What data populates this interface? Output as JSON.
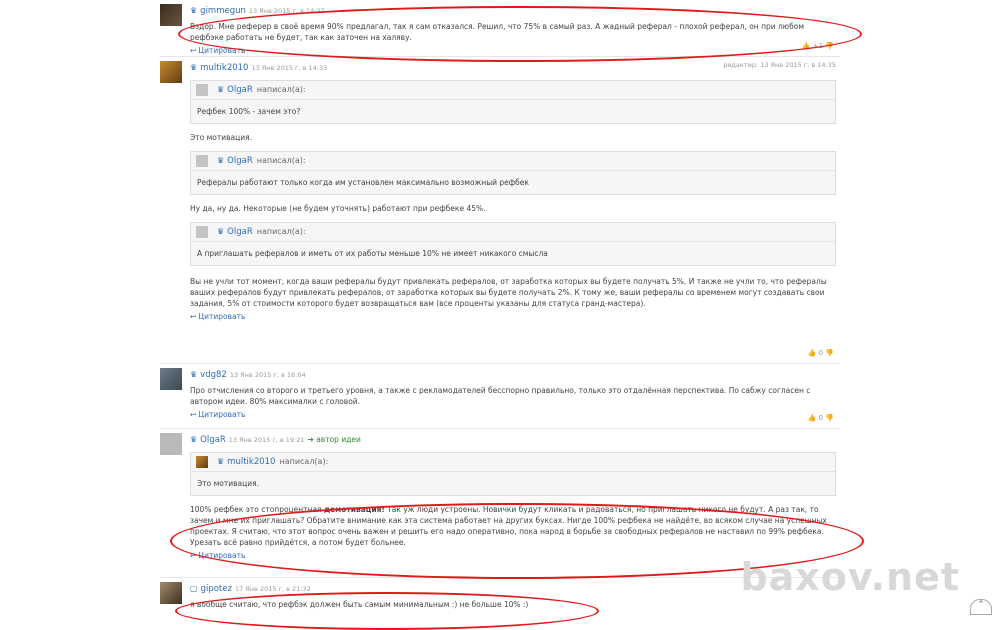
{
  "posts": [
    {
      "user": "gimmegun",
      "date": "13 Янв 2015 г, в 14:27",
      "text": "Вздор. Мне реферер в своё время 90% предлагал, так я сам отказался. Решил, что 75% в самый раз. А жадный реферал - плохой реферал, он при любом рефбэке работать не будет, так как заточен на халяву.",
      "cite": "Цитировать",
      "votes": "+1"
    },
    {
      "user": "multik2010",
      "date": "13 Янв 2015 г, в 14:33",
      "edited": "редактир: 13 Янв 2015 г, в 14:35",
      "quote1_user": "OlgaR",
      "wrote": "написал(а):",
      "quote1": "Рефбек 100% - зачем это?",
      "text1": "Это мотивация.",
      "quote2_user": "OlgaR",
      "quote2": "Рефералы работают только когда им установлен максимально возможный рефбек",
      "text2": "Ну да, ну да. Некоторые (не будем уточнять) работают при рефбеке 45%.",
      "quote3_user": "OlgaR",
      "quote3": "А приглашать рефералов и иметь от их работы меньше 10% не имеет никакого смысла",
      "text3": "Вы не учли тот момент, когда ваши рефералы будут привлекать рефералов, от заработка которых вы будете получать 5%. И также не учли то, что рефералы ваших рефералов будут привлекать рефералов, от заработка которых вы будете получать 2%. К тому же, ваши рефералы со временем могут создавать свои задания, 5% от стоимости которого будет возвращаться вам (все проценты указаны для статуса гранд-мастера).",
      "cite": "Цитировать",
      "votes": "0"
    },
    {
      "user": "vdg82",
      "date": "13 Янв 2015 г, в 16:04",
      "text": "Про отчисления со второго и третьего уровня, а также с рекламодателей бесспорно правильно, только это отдалённая перспектива. По сабжу согласен с автором идеи. 80% максималки с головой.",
      "cite": "Цитировать",
      "votes": "0"
    },
    {
      "user": "OlgaR",
      "date": "13 Янв 2015 г, в 19:21",
      "author": "автор идеи",
      "quote1_user": "multik2010",
      "wrote": "написал(а):",
      "quote1": "Это мотивация.",
      "text_pre": "100% рефбек это стопроцентная ",
      "text_bold": "демотивация!",
      "text_post": " Так уж люди устроены. Новички будут кликать и радоваться, но приглашать никого не будут. А раз так, то зачем и мне их приглашать? Обратите внимание как эта система работает на других буксах. Нигде 100% рефбека не найдёте, во всяком случае на успешных проектах. Я считаю, что этот вопрос очень важен и решить его надо оперативно, пока народ в борьбе за свободных рефералов не наставил по 99% рефбека. Урезать всё равно прийдётся, а потом будет больнее.",
      "cite": "Цитировать",
      "votes": "0"
    },
    {
      "user": "gipotez",
      "date": "17 Янв 2015 г, в 21:32",
      "text": "я вообще считаю, что рефбэк должен быть самым минимальным :) не больше 10% :)"
    }
  ],
  "watermark": "baxov.net"
}
